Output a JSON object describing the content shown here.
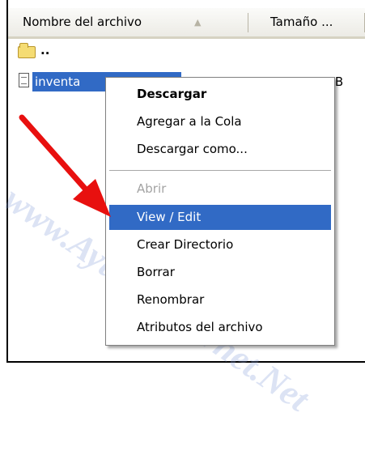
{
  "columns": [
    {
      "label": "Nombre del archivo",
      "sort_icon": "sort-up-arrow-icon"
    },
    {
      "label": "Tamaño ..."
    }
  ],
  "rows": [
    {
      "icon": "folder-icon",
      "name": ".."
    },
    {
      "icon": "file-icon",
      "name": "inventa",
      "size": "KB",
      "selected": true
    }
  ],
  "context_menu": {
    "items": [
      {
        "label": "Descargar",
        "style": "bold"
      },
      {
        "label": "Agregar a la Cola"
      },
      {
        "label": "Descargar como..."
      },
      {
        "type": "separator"
      },
      {
        "label": "Abrir",
        "disabled": true
      },
      {
        "label": "View / Edit",
        "highlighted": true
      },
      {
        "label": "Crear Directorio"
      },
      {
        "label": "Borrar"
      },
      {
        "label": "Renombrar"
      },
      {
        "label": "Atributos del archivo"
      }
    ]
  },
  "annotation": {
    "icon": "red-arrow-icon",
    "color": "#e8100f"
  },
  "watermark": {
    "text": "www.Ayuda-Internet.Net"
  },
  "colors": {
    "selection": "#316ac5",
    "selection_text": "#ffffff",
    "disabled_text": "#a3a3a3"
  }
}
